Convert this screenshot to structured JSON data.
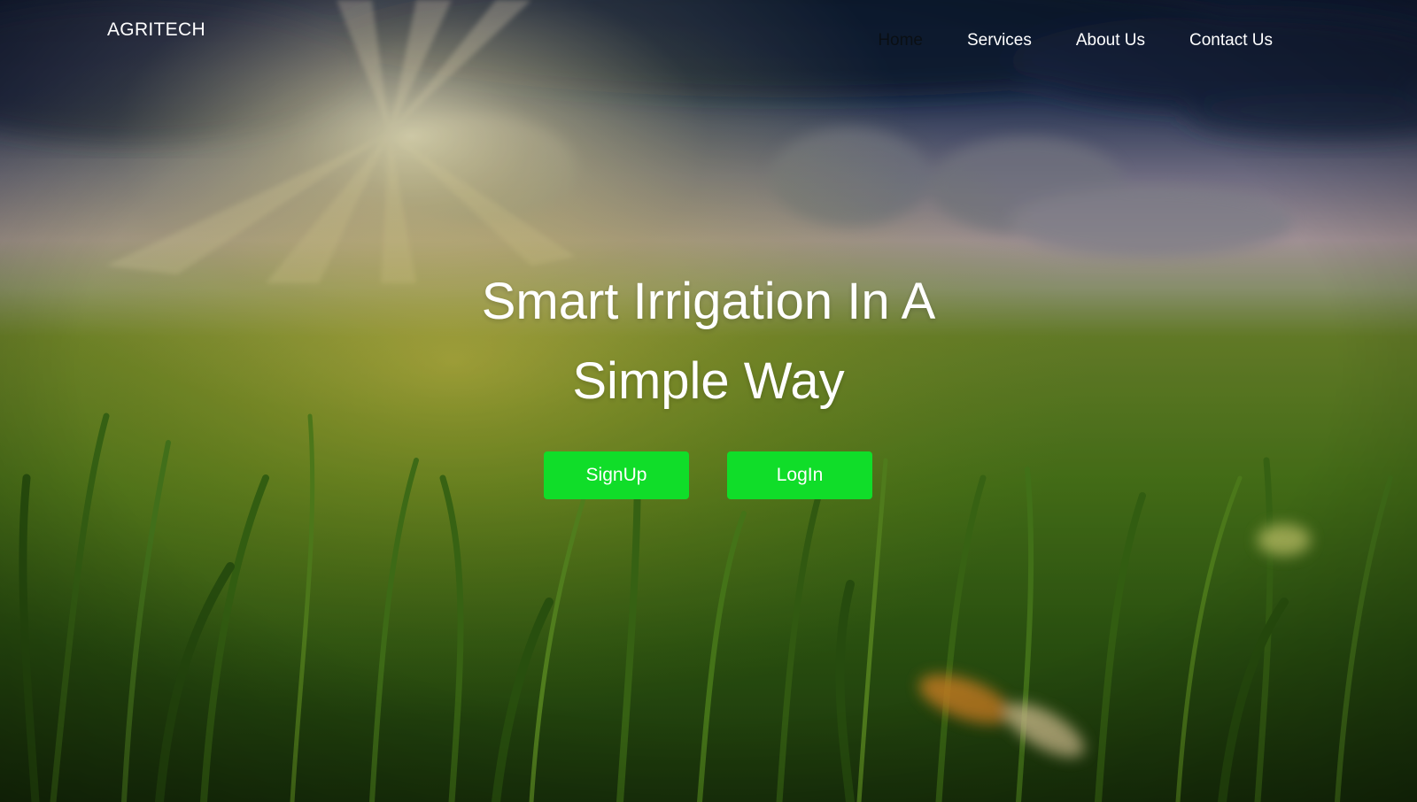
{
  "brand": {
    "name": "AGRITECH"
  },
  "nav": {
    "items": [
      {
        "label": "Home",
        "active": true
      },
      {
        "label": "Services",
        "active": false
      },
      {
        "label": "About Us",
        "active": false
      },
      {
        "label": "Contact Us",
        "active": false
      }
    ]
  },
  "hero": {
    "title_line1": "Smart Irrigation In A",
    "title_line2": "Simple Way",
    "background": "sunlit-grass-field-photo"
  },
  "actions": {
    "signup_label": "SignUp",
    "login_label": "LogIn"
  },
  "colors": {
    "button_bg": "#10dd29",
    "button_text": "#ffffff",
    "nav_text": "#ffffff",
    "nav_active_text": "#0a0f14"
  }
}
